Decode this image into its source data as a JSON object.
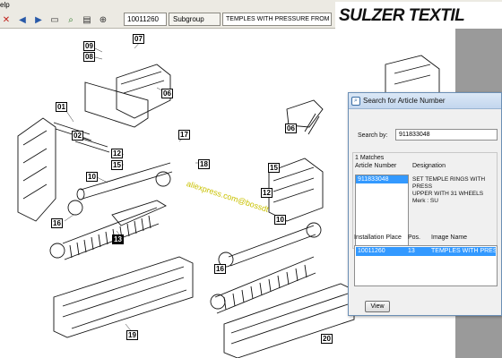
{
  "menu": {
    "help_fragment": "elp"
  },
  "toolbar": {
    "article_no": "10011260",
    "subgroup_label": "Subgroup",
    "title": "TEMPLES WITH PRESSURE FROM ABOVE",
    "brand": "SULZER TEXTIL"
  },
  "drawing": {
    "callouts": [
      {
        "label": "09"
      },
      {
        "label": "08"
      },
      {
        "label": "07"
      },
      {
        "label": "06"
      },
      {
        "label": "01"
      },
      {
        "label": "02"
      },
      {
        "label": "12"
      },
      {
        "label": "15"
      },
      {
        "label": "17"
      },
      {
        "label": "18"
      },
      {
        "label": "10"
      },
      {
        "label": "16"
      },
      {
        "label": "13"
      },
      {
        "label": "19"
      },
      {
        "label": "15"
      },
      {
        "label": "06"
      },
      {
        "label": "12"
      },
      {
        "label": "10"
      },
      {
        "label": "16"
      },
      {
        "label": "20"
      }
    ],
    "watermark": "aliexpress.com@bossdt"
  },
  "dialog": {
    "title": "Search for Article Number",
    "search_by_label": "Search by:",
    "search_value": "911833048",
    "matches_label": "1 Matches",
    "article_col": "Article Number",
    "designation_col": "Designation",
    "match": {
      "article": "911833048",
      "designation": "SET TEMPLE RINGS WITH PRESS\nUPPER WITH 31 WHEELS\nMerk : SU"
    },
    "install_col": "Installation Place",
    "pos_col": "Pos.",
    "image_col": "Image Name",
    "install_row": {
      "place": "10011260",
      "pos": "13",
      "image": "TEMPLES WITH PRESSURE"
    },
    "view_button": "View"
  }
}
